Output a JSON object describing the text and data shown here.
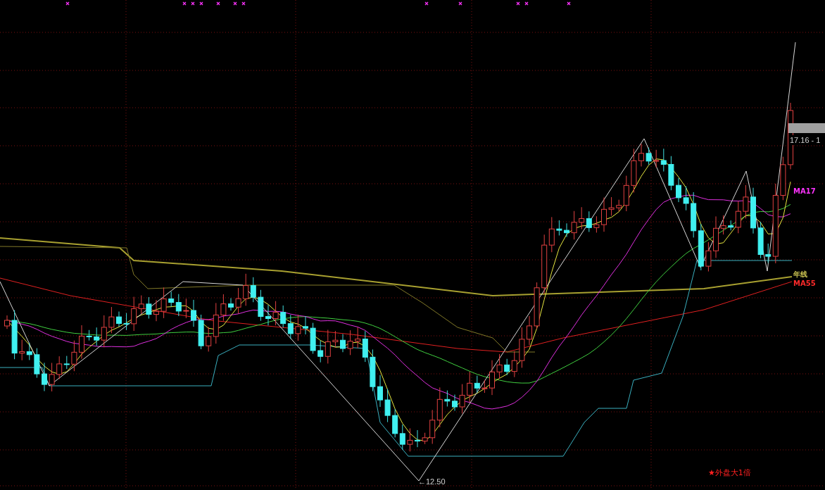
{
  "chart": {
    "price_high_label": "17.16 - 1",
    "price_low_label": "←12.50",
    "line_labels": [
      {
        "text": "MA17",
        "color": "#ff33ff"
      },
      {
        "text": "年线",
        "color": "#c8c050"
      },
      {
        "text": "MA55",
        "color": "#ff2a2a"
      }
    ],
    "signal": "★外盘大1倍"
  }
}
